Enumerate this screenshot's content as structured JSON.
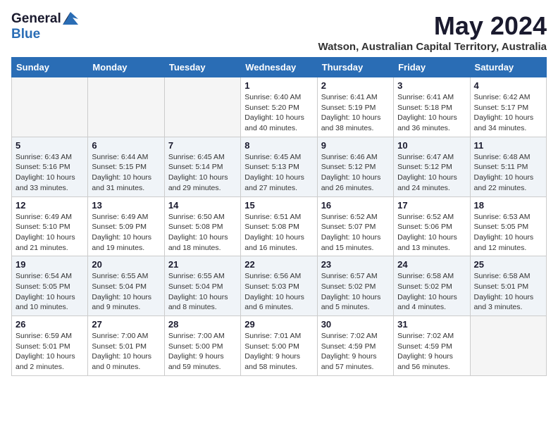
{
  "header": {
    "logo_general": "General",
    "logo_blue": "Blue",
    "title": "May 2024",
    "subtitle": "Watson, Australian Capital Territory, Australia"
  },
  "calendar": {
    "days_of_week": [
      "Sunday",
      "Monday",
      "Tuesday",
      "Wednesday",
      "Thursday",
      "Friday",
      "Saturday"
    ],
    "weeks": [
      [
        {
          "day": "",
          "info": ""
        },
        {
          "day": "",
          "info": ""
        },
        {
          "day": "",
          "info": ""
        },
        {
          "day": "1",
          "info": "Sunrise: 6:40 AM\nSunset: 5:20 PM\nDaylight: 10 hours\nand 40 minutes."
        },
        {
          "day": "2",
          "info": "Sunrise: 6:41 AM\nSunset: 5:19 PM\nDaylight: 10 hours\nand 38 minutes."
        },
        {
          "day": "3",
          "info": "Sunrise: 6:41 AM\nSunset: 5:18 PM\nDaylight: 10 hours\nand 36 minutes."
        },
        {
          "day": "4",
          "info": "Sunrise: 6:42 AM\nSunset: 5:17 PM\nDaylight: 10 hours\nand 34 minutes."
        }
      ],
      [
        {
          "day": "5",
          "info": "Sunrise: 6:43 AM\nSunset: 5:16 PM\nDaylight: 10 hours\nand 33 minutes."
        },
        {
          "day": "6",
          "info": "Sunrise: 6:44 AM\nSunset: 5:15 PM\nDaylight: 10 hours\nand 31 minutes."
        },
        {
          "day": "7",
          "info": "Sunrise: 6:45 AM\nSunset: 5:14 PM\nDaylight: 10 hours\nand 29 minutes."
        },
        {
          "day": "8",
          "info": "Sunrise: 6:45 AM\nSunset: 5:13 PM\nDaylight: 10 hours\nand 27 minutes."
        },
        {
          "day": "9",
          "info": "Sunrise: 6:46 AM\nSunset: 5:12 PM\nDaylight: 10 hours\nand 26 minutes."
        },
        {
          "day": "10",
          "info": "Sunrise: 6:47 AM\nSunset: 5:12 PM\nDaylight: 10 hours\nand 24 minutes."
        },
        {
          "day": "11",
          "info": "Sunrise: 6:48 AM\nSunset: 5:11 PM\nDaylight: 10 hours\nand 22 minutes."
        }
      ],
      [
        {
          "day": "12",
          "info": "Sunrise: 6:49 AM\nSunset: 5:10 PM\nDaylight: 10 hours\nand 21 minutes."
        },
        {
          "day": "13",
          "info": "Sunrise: 6:49 AM\nSunset: 5:09 PM\nDaylight: 10 hours\nand 19 minutes."
        },
        {
          "day": "14",
          "info": "Sunrise: 6:50 AM\nSunset: 5:08 PM\nDaylight: 10 hours\nand 18 minutes."
        },
        {
          "day": "15",
          "info": "Sunrise: 6:51 AM\nSunset: 5:08 PM\nDaylight: 10 hours\nand 16 minutes."
        },
        {
          "day": "16",
          "info": "Sunrise: 6:52 AM\nSunset: 5:07 PM\nDaylight: 10 hours\nand 15 minutes."
        },
        {
          "day": "17",
          "info": "Sunrise: 6:52 AM\nSunset: 5:06 PM\nDaylight: 10 hours\nand 13 minutes."
        },
        {
          "day": "18",
          "info": "Sunrise: 6:53 AM\nSunset: 5:05 PM\nDaylight: 10 hours\nand 12 minutes."
        }
      ],
      [
        {
          "day": "19",
          "info": "Sunrise: 6:54 AM\nSunset: 5:05 PM\nDaylight: 10 hours\nand 10 minutes."
        },
        {
          "day": "20",
          "info": "Sunrise: 6:55 AM\nSunset: 5:04 PM\nDaylight: 10 hours\nand 9 minutes."
        },
        {
          "day": "21",
          "info": "Sunrise: 6:55 AM\nSunset: 5:04 PM\nDaylight: 10 hours\nand 8 minutes."
        },
        {
          "day": "22",
          "info": "Sunrise: 6:56 AM\nSunset: 5:03 PM\nDaylight: 10 hours\nand 6 minutes."
        },
        {
          "day": "23",
          "info": "Sunrise: 6:57 AM\nSunset: 5:02 PM\nDaylight: 10 hours\nand 5 minutes."
        },
        {
          "day": "24",
          "info": "Sunrise: 6:58 AM\nSunset: 5:02 PM\nDaylight: 10 hours\nand 4 minutes."
        },
        {
          "day": "25",
          "info": "Sunrise: 6:58 AM\nSunset: 5:01 PM\nDaylight: 10 hours\nand 3 minutes."
        }
      ],
      [
        {
          "day": "26",
          "info": "Sunrise: 6:59 AM\nSunset: 5:01 PM\nDaylight: 10 hours\nand 2 minutes."
        },
        {
          "day": "27",
          "info": "Sunrise: 7:00 AM\nSunset: 5:01 PM\nDaylight: 10 hours\nand 0 minutes."
        },
        {
          "day": "28",
          "info": "Sunrise: 7:00 AM\nSunset: 5:00 PM\nDaylight: 9 hours\nand 59 minutes."
        },
        {
          "day": "29",
          "info": "Sunrise: 7:01 AM\nSunset: 5:00 PM\nDaylight: 9 hours\nand 58 minutes."
        },
        {
          "day": "30",
          "info": "Sunrise: 7:02 AM\nSunset: 4:59 PM\nDaylight: 9 hours\nand 57 minutes."
        },
        {
          "day": "31",
          "info": "Sunrise: 7:02 AM\nSunset: 4:59 PM\nDaylight: 9 hours\nand 56 minutes."
        },
        {
          "day": "",
          "info": ""
        }
      ]
    ]
  }
}
